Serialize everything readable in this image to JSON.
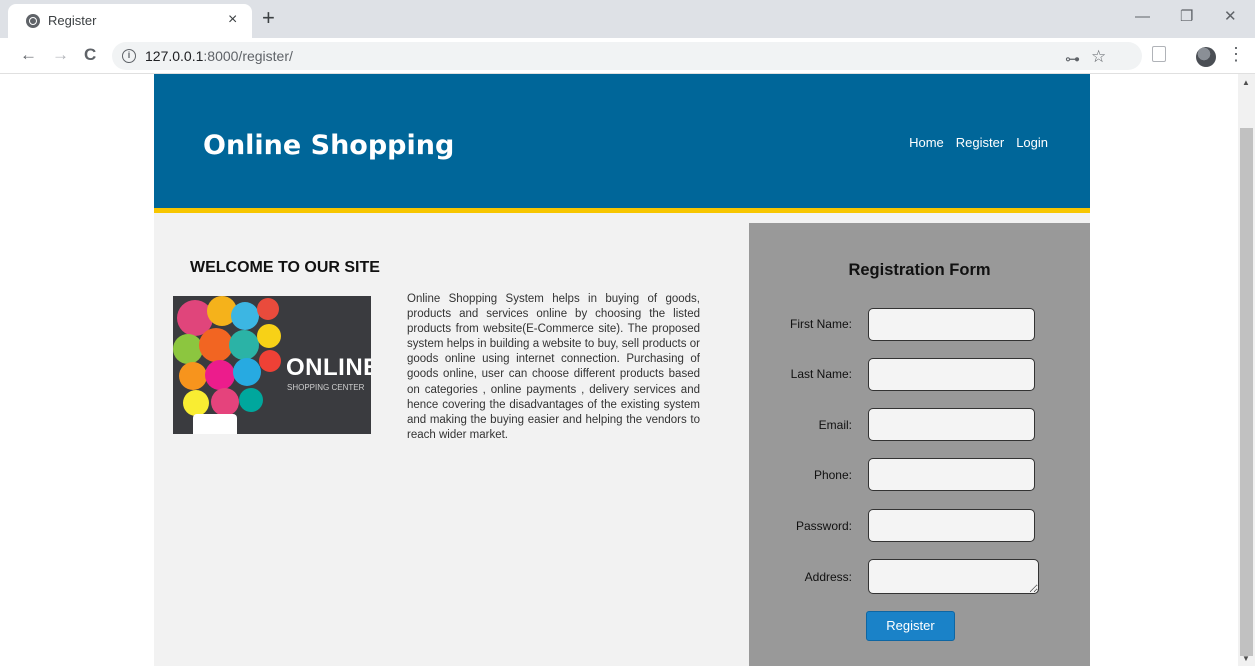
{
  "browser": {
    "tab_title": "Register",
    "tab_close": "×",
    "new_tab": "+",
    "url_host": "127.0.0.1",
    "url_path": ":8000/register/",
    "window_controls": {
      "minimize": "—",
      "restore": "❐",
      "close": "✕"
    },
    "nav": {
      "back": "←",
      "forward": "→",
      "reload": "C"
    },
    "toolbar_icons": {
      "key": "⊶",
      "star": "☆",
      "menu": "⋮"
    }
  },
  "site": {
    "title": "Online Shopping",
    "nav": [
      "Home",
      "Register",
      "Login"
    ]
  },
  "main": {
    "welcome_heading": "WELCOME TO OUR SITE",
    "promo_title": "ONLINE",
    "promo_subtitle": "SHOPPING CENTER",
    "about_text": "Online Shopping System helps in buying of goods, products and services online by choosing the listed products from website(E-Commerce site). The proposed system helps in building a website to buy, sell products or goods online using internet connection. Purchasing of goods online, user can choose different products based on categories , online payments , delivery services and hence covering the disadvantages of the existing system and making the buying easier and helping the vendors to reach wider market."
  },
  "form": {
    "title": "Registration Form",
    "fields": [
      {
        "label": "First Name:",
        "value": ""
      },
      {
        "label": "Last Name:",
        "value": ""
      },
      {
        "label": "Email:",
        "value": ""
      },
      {
        "label": "Phone:",
        "value": ""
      },
      {
        "label": "Password:",
        "value": ""
      },
      {
        "label": "Address:",
        "value": ""
      }
    ],
    "submit_label": "Register"
  },
  "colors": {
    "header": "#006699",
    "header_border": "#f7c600",
    "form_panel": "#999999",
    "button": "#1a82c8",
    "page_bg": "#f2f2f2"
  }
}
